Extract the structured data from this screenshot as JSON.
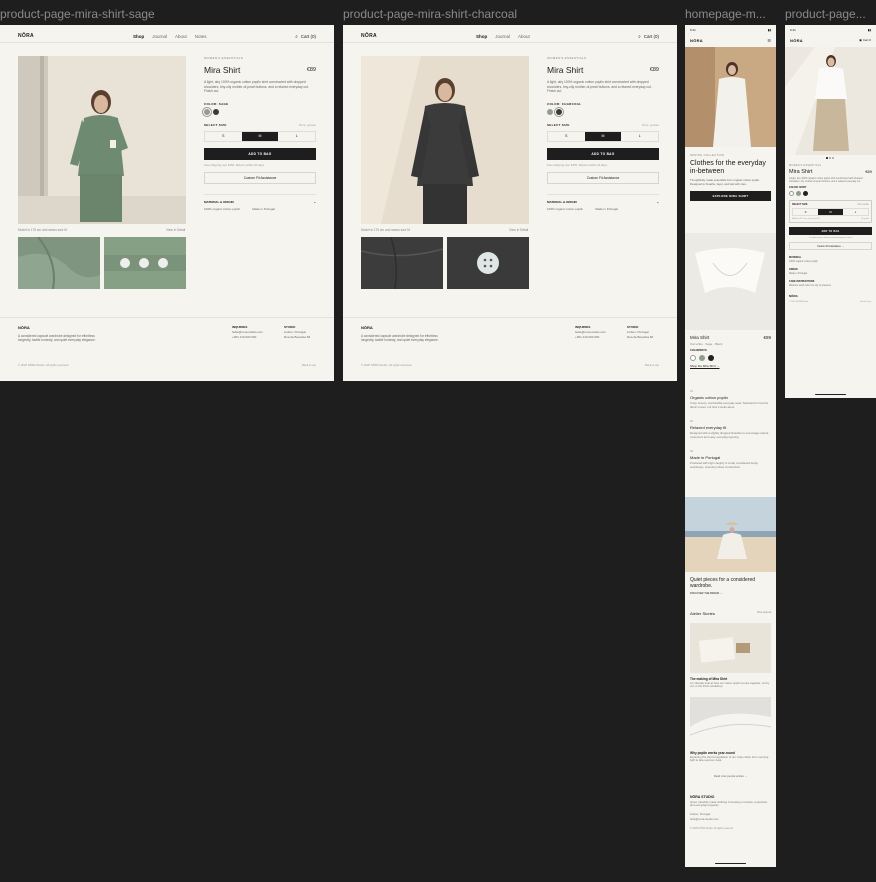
{
  "frame_labels": [
    "product-page-mira-shirt-sage",
    "product-page-mira-shirt-charcoal",
    "homepage-m...",
    "product-page..."
  ],
  "brand": "NŌRA",
  "nav": {
    "items": [
      "Shop",
      "Journal",
      "About"
    ],
    "cart": "Cart (0)"
  },
  "product": {
    "eyebrow": "WOMEN'S ESSENTIALS",
    "title": "Mira Shirt",
    "price": "€89",
    "description": "A light, airy 100% organic cotton poplin shirt constructed with dropped shoulders, tiny-city mother-of-pearl buttons, and a relaxed everyday cut. Finish cut.",
    "color_label_sage": "COLOR: SAGE",
    "color_label_charcoal": "COLOR: CHARCOAL",
    "size_label": "SELECT SIZE",
    "size_guide": "Size guide",
    "sizes": [
      "S",
      "M",
      "L"
    ],
    "selected_size": "M",
    "add_to_bag": "ADD TO BAG",
    "ship_note": "Free shipping over €150. Returns within 30 days.",
    "custom_fit": "Custom Fit Assistance",
    "material_label": "MATERIAL & ORIGIN",
    "feature1": "100% organic cotton poplin",
    "feature2": "Made in Portugal",
    "caption_sage": "Model is 175 cm and wears size M",
    "caption_charcoal": "Model is 175 cm and wears size M",
    "view_all": "View in Detail"
  },
  "footer": {
    "brand": "NŌRA",
    "tagline": "A considered capsule wardrobe designed for effortless longevity, tactile honesty, and quiet everyday elegance.",
    "col1_title": "INQUIRIES",
    "col1_lines": [
      "hello@nora-studio.com",
      "+351 210 000 000"
    ],
    "col2_title": "STUDIO",
    "col2_lines": [
      "Lisbon, Portugal",
      "Rua da Boavista 84"
    ],
    "copyright": "© 2025 NŌRA Studio. All rights reserved.",
    "back_to_top": "Back to top"
  },
  "mobile_home": {
    "status_time": "9:41",
    "eyebrow": "SPRING COLLECTION",
    "hero_title": "Clothes for the everyday in-between",
    "hero_text": "Thoughtfully made essentials from organic cotton poplin. Designed to breathe, layer, and last with care.",
    "hero_cta": "EXPLORE MIRA SHIRT",
    "product_name": "Mira Shirt",
    "product_price": "€89",
    "product_colors": "Oat white · Sage · Black",
    "colorways": "COLORWAYS",
    "shop_link": "Shop the Mira Shirt →",
    "features": [
      {
        "num": "01",
        "title": "Organic cotton poplin",
        "text": "Crisp, breezy, comfortable everyday wear. Selected for how the fabric moves, not how it looks alone."
      },
      {
        "num": "02",
        "title": "Relaxed everyday fit",
        "text": "Designed with a slightly dropped shoulder to encourage natural movement and easy, everyday layering."
      },
      {
        "num": "03",
        "title": "Made in Portugal",
        "text": "Produced with high integrity in small, considered family workshops, ensuring robust construction."
      }
    ],
    "editorial_title": "Quiet pieces for a considered wardrobe.",
    "editorial_link": "DISCOVER THE BRAND →",
    "stories_title": "Atelier Stories",
    "stories_view": "View journal",
    "story1_title": "The making of Mira Shirt",
    "story1_text": "An intimate look at how our cotton poplin comes together, cut by cut, in the Porto workshop.",
    "story2_title": "Why poplin works year-round",
    "story2_text": "Exploring the thermoregulation of our crisp cotton from morning light to late-summer dusk.",
    "read_more": "Read more journal entries →",
    "studio_title": "NŌRA STUDIO",
    "studio_text": "Quiet, carefully made clothing. Focusing on texture, proportion, and everyday longevity.",
    "studio_lines": [
      "Lisbon, Portugal",
      "hello@nora-studio.com"
    ],
    "copyright": "© 2025 NŌRA Studio. All rights reserved."
  },
  "mobile_product": {
    "status_time": "9:41",
    "cart": "Cart 0",
    "eyebrow": "WOMEN'S ESSENTIALS",
    "title": "Mira Shirt",
    "price": "€89",
    "description": "A light, airy 100% organic cotton poplin shirt constructed with dropped shoulders, tiny mother-of-pearl buttons, and a relaxed everyday cut.",
    "color_label": "COLOR: IVORY",
    "size_label": "SELECT SIZE",
    "size_guide": "Size Guide",
    "sizes": [
      "S",
      "M",
      "L"
    ],
    "size_note": "Model is 175 cm, wears size M",
    "size_note_right": "Fit guide",
    "add_to_bag": "ADD TO BAG",
    "ship_note": "Complimentary carbon-neutral shipping & returns",
    "custom_fit": "Custom Fit Assistance →",
    "material_title": "MATERIAL",
    "material_text": "100% organic cotton poplin",
    "origin_title": "ORIGIN",
    "origin_text": "Made in Portugal",
    "care_title": "CARE INSTRUCTIONS",
    "care_text": "Machine wash cold, line dry to preserve.",
    "footer_brand": "NŌRA",
    "footer_copy": "© 2025 NŌRA Studio",
    "footer_top": "Back to top ↑"
  },
  "colors": {
    "sage": "#8fa08a",
    "charcoal": "#3a3a3a",
    "ivory": "#ece8df",
    "accent": "#1e1e1e",
    "canvas": "#1e1e1e",
    "paper": "#f6f4ef"
  }
}
